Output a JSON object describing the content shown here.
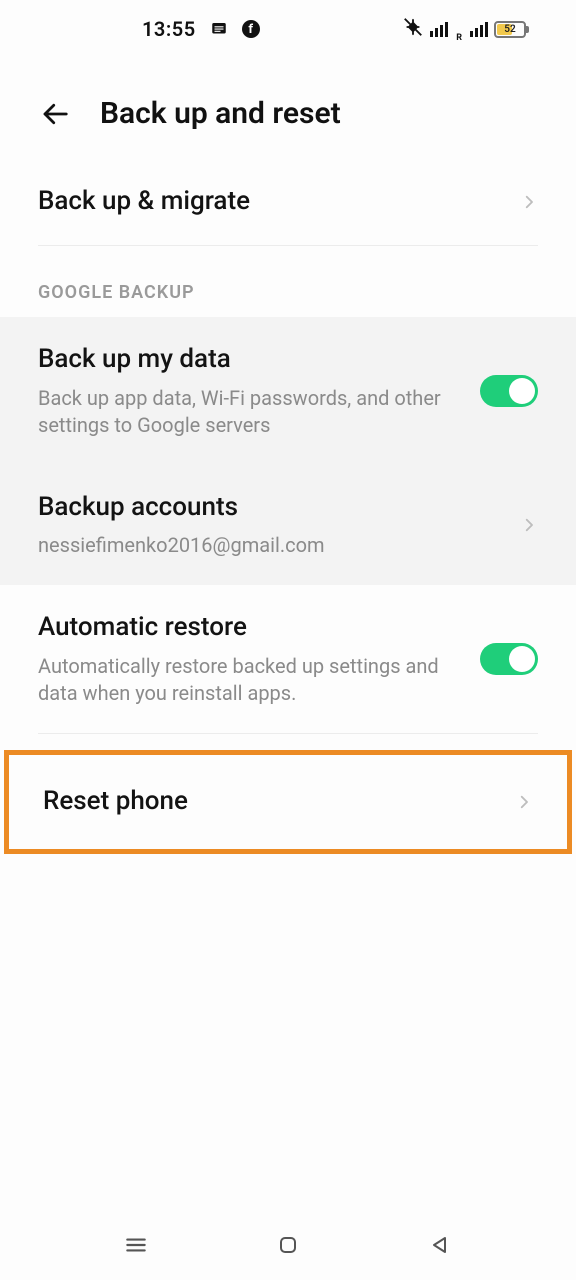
{
  "status": {
    "time": "13:55",
    "battery_pct": 52,
    "roaming_label": "R"
  },
  "header": {
    "title": "Back up and reset"
  },
  "rows": {
    "backup_migrate": {
      "title": "Back up & migrate"
    },
    "section_google": "GOOGLE BACKUP",
    "backup_my_data": {
      "title": "Back up my data",
      "sub": "Back up app data, Wi-Fi passwords, and other settings to Google servers"
    },
    "backup_accounts": {
      "title": "Backup accounts",
      "sub": "nessiefimenko2016@gmail.com"
    },
    "auto_restore": {
      "title": "Automatic restore",
      "sub": "Automatically restore backed up settings and data when you reinstall apps."
    },
    "reset_phone": {
      "title": "Reset phone"
    }
  }
}
